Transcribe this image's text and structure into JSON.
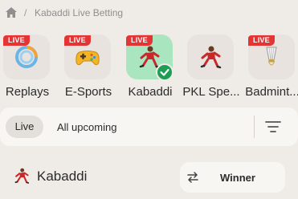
{
  "breadcrumb": {
    "home_icon": "home-icon",
    "separator": "/",
    "current": "Kabaddi Live Betting"
  },
  "sports": [
    {
      "label": "Replays",
      "live": "LIVE",
      "icon": "replay-ring-icon",
      "selected": false
    },
    {
      "label": "E-Sports",
      "live": "LIVE",
      "icon": "gamepad-icon",
      "selected": false
    },
    {
      "label": "Kabaddi",
      "live": "LIVE",
      "icon": "kabaddi-player-icon",
      "selected": true
    },
    {
      "label": "PKL Spe...",
      "live": "",
      "icon": "kabaddi-player-icon",
      "selected": false
    },
    {
      "label": "Badmint...",
      "live": "LIVE",
      "icon": "shuttlecock-icon",
      "selected": false
    }
  ],
  "filters": {
    "live": "Live",
    "upcoming": "All upcoming",
    "filter_icon": "filter-lines-icon"
  },
  "section": {
    "title": "Kabaddi",
    "icon": "kabaddi-player-icon",
    "market_button": "Winner",
    "market_icon": "swap-arrows-icon"
  },
  "colors": {
    "live_badge": "#e53434",
    "selected_tile": "#a9e6c0",
    "check": "#1f9d55",
    "background": "#efebe6"
  }
}
